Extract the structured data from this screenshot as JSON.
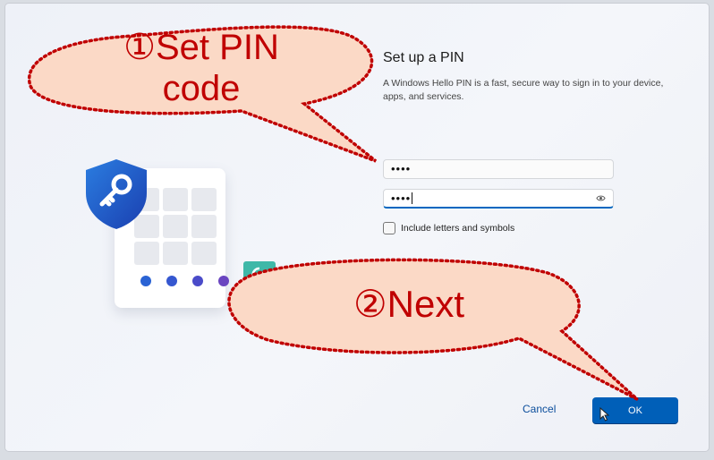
{
  "setup": {
    "title": "Set up a PIN",
    "description": "A Windows Hello PIN is a fast, secure way to sign in to your device, apps, and services.",
    "pin_value": "••••",
    "confirm_pin_value": "••••",
    "include_letters_label": "Include letters and symbols",
    "include_letters_checked": false,
    "cancel_label": "Cancel",
    "ok_label": "OK"
  },
  "annotations": {
    "step1": "①Set PIN",
    "step1_line2": "code",
    "step2": "②Next"
  },
  "colors": {
    "accent": "#005fb8",
    "annotation_red": "#c00000",
    "bubble_fill": "#fbd9c6"
  },
  "illustration": {
    "pin_dots": 4,
    "icons": [
      "shield-key-icon",
      "keypad-icon"
    ]
  }
}
